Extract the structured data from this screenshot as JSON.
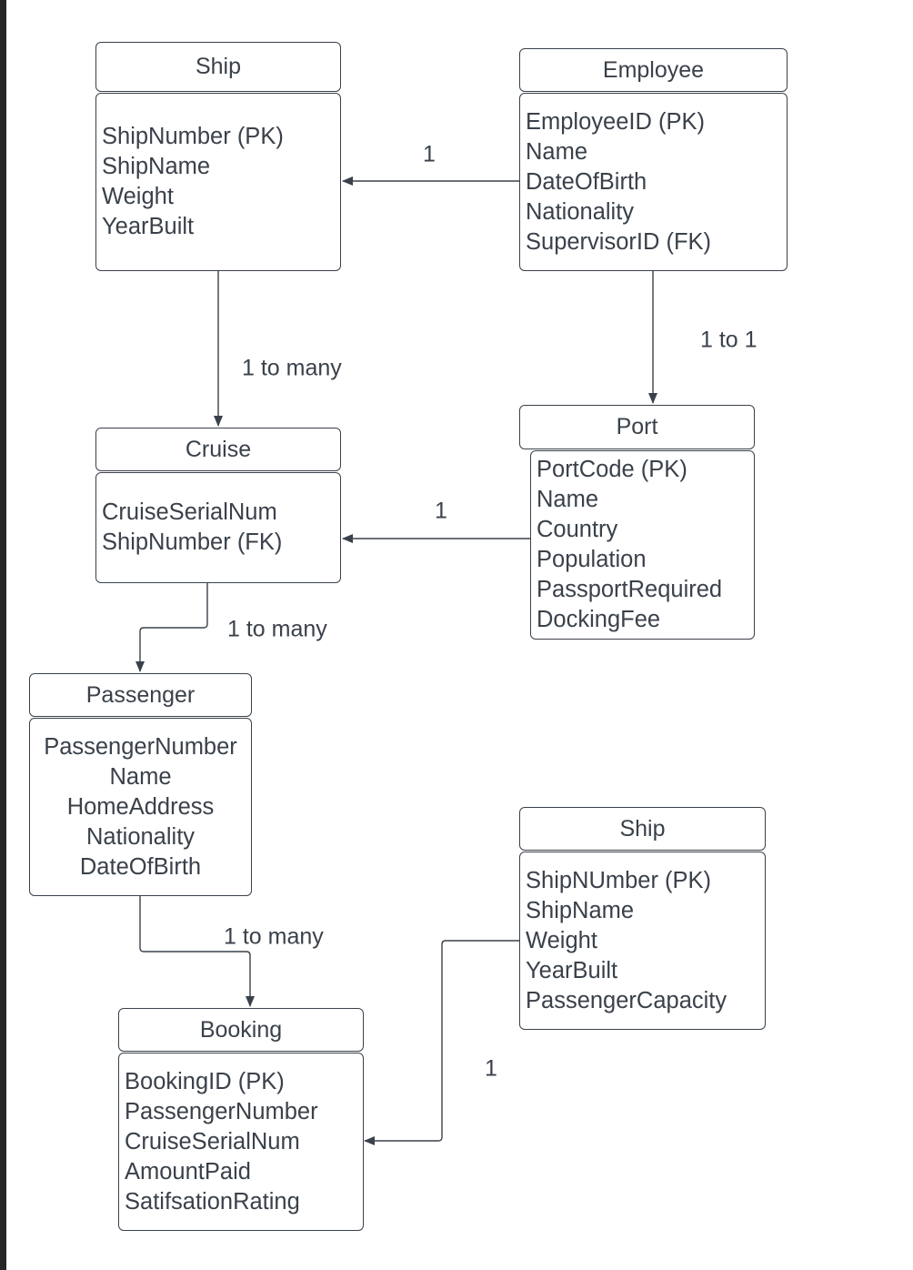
{
  "entities": {
    "ship": {
      "title": "Ship",
      "attributes": [
        "ShipNumber (PK)",
        "ShipName",
        "Weight",
        "YearBuilt"
      ]
    },
    "employee": {
      "title": "Employee",
      "attributes": [
        "EmployeeID (PK)",
        "Name",
        "DateOfBirth",
        "Nationality",
        "SupervisorID (FK)"
      ]
    },
    "cruise": {
      "title": "Cruise",
      "attributes": [
        "CruiseSerialNum",
        "ShipNumber (FK)"
      ]
    },
    "port": {
      "title": "Port",
      "attributes": [
        "PortCode (PK)",
        "Name",
        "Country",
        "Population",
        "PassportRequired",
        "DockingFee"
      ]
    },
    "passenger": {
      "title": "Passenger",
      "attributes": [
        "PassengerNumber",
        "Name",
        "HomeAddress",
        "Nationality",
        "DateOfBirth"
      ]
    },
    "ship2": {
      "title": "Ship",
      "attributes": [
        "ShipNUmber (PK)",
        "ShipName",
        "Weight",
        "YearBuilt",
        "PassengerCapacity"
      ]
    },
    "booking": {
      "title": "Booking",
      "attributes": [
        "BookingID (PK)",
        "PassengerNumber",
        "CruiseSerialNum",
        "AmountPaid",
        "SatifsationRating"
      ]
    }
  },
  "relationships": [
    {
      "from": "Employee",
      "to": "Ship",
      "label": "1"
    },
    {
      "from": "Ship",
      "to": "Cruise",
      "label": "1 to many"
    },
    {
      "from": "Employee",
      "to": "Port",
      "label": "1 to 1"
    },
    {
      "from": "Port",
      "to": "Cruise",
      "label": "1"
    },
    {
      "from": "Cruise",
      "to": "Passenger",
      "label": "1 to many"
    },
    {
      "from": "Passenger",
      "to": "Booking",
      "label": "1 to many"
    },
    {
      "from": "Ship",
      "to": "Booking",
      "label": "1"
    }
  ],
  "colors": {
    "stroke": "#3a414a",
    "text": "#3a414a",
    "background": "#ffffff"
  }
}
